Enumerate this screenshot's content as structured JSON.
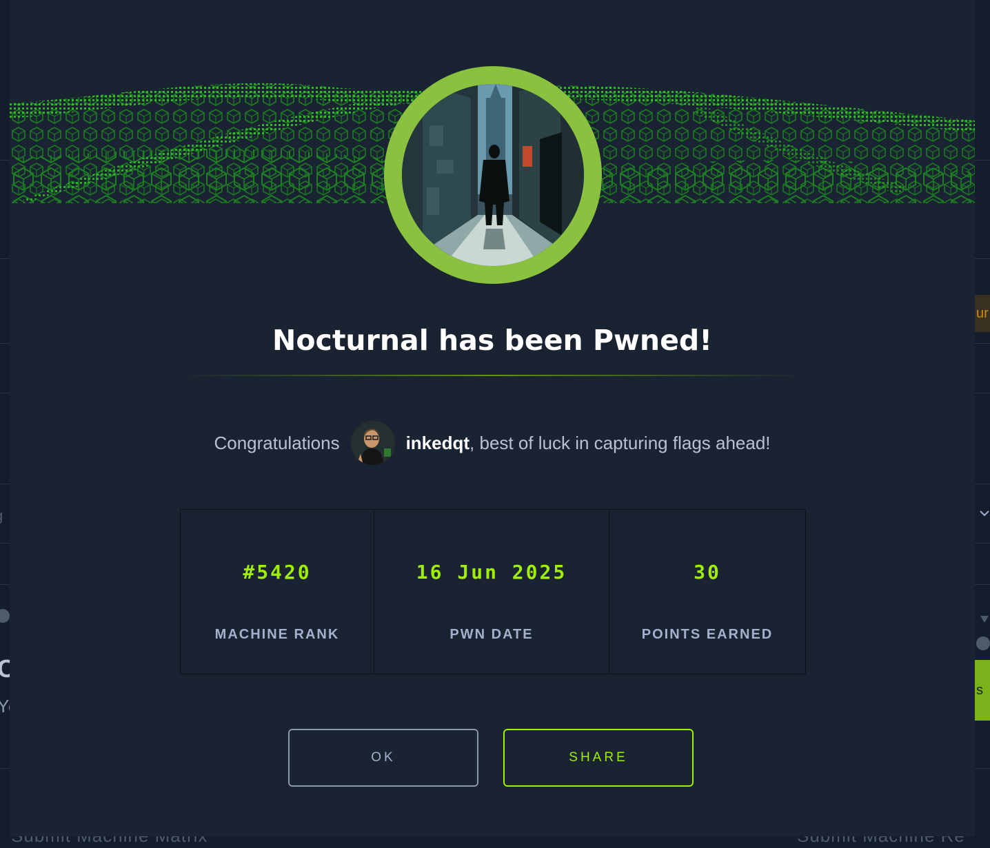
{
  "background": {
    "bottom_left_text": "Submit Machine Matrix",
    "bottom_right_text": "Submit Machine Re",
    "left_fragments": [
      "g",
      "C",
      "Yo"
    ],
    "right_fragments": [
      "ur",
      "s"
    ]
  },
  "modal": {
    "title": "Nocturnal has been Pwned!",
    "congrats_prefix": "Congratulations",
    "username": "inkedqt",
    "congrats_suffix": ", best of luck in capturing flags ahead!",
    "stats": [
      {
        "value": "#5420",
        "label": "MACHINE RANK"
      },
      {
        "value": "16 Jun 2025",
        "label": "PWN DATE"
      },
      {
        "value": "30",
        "label": "POINTS EARNED"
      }
    ],
    "buttons": {
      "ok_label": "OK",
      "share_label": "SHARE"
    }
  },
  "colors": {
    "accent": "#9fef00",
    "avatar_ring": "#8ac13e",
    "modal_bg": "#1a2332",
    "page_bg": "#141d2b"
  },
  "icons": {
    "machine_avatar": "machine-avatar-icon",
    "user_avatar": "user-avatar-icon",
    "banner": "green-wave-cubes-banner"
  }
}
